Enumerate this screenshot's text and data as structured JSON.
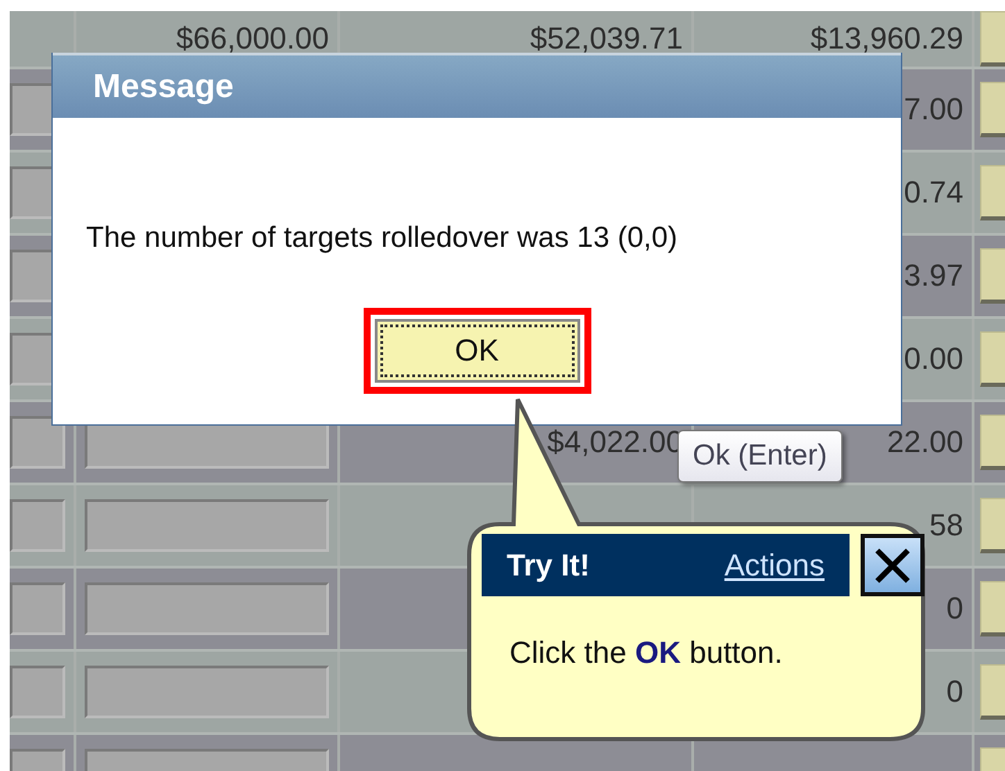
{
  "grid": {
    "rows": [
      {
        "kind": "total",
        "column_2": "$66,000.00",
        "column_3": "$52,039.71",
        "column_4": "$13,960.29"
      },
      {
        "kind": "partial",
        "column_4": "7.00"
      },
      {
        "kind": "partial",
        "column_4": "0.74"
      },
      {
        "kind": "partial",
        "column_4": "3.97"
      },
      {
        "kind": "partial",
        "column_4": "0.00"
      },
      {
        "kind": "full",
        "column_3": "$4,022.00",
        "column_4": "22.00"
      },
      {
        "kind": "full",
        "column_4": "58"
      },
      {
        "kind": "full",
        "column_4": "0"
      },
      {
        "kind": "full",
        "column_4": "0"
      },
      {
        "kind": "full"
      }
    ]
  },
  "dialog": {
    "title": "Message",
    "message": "The number of targets rolledover was 13 (0,0)",
    "button": "OK",
    "tooltip": "Ok (Enter)"
  },
  "callout": {
    "title": "Try It!",
    "link": "Actions",
    "text": "Click the **OK** button."
  }
}
